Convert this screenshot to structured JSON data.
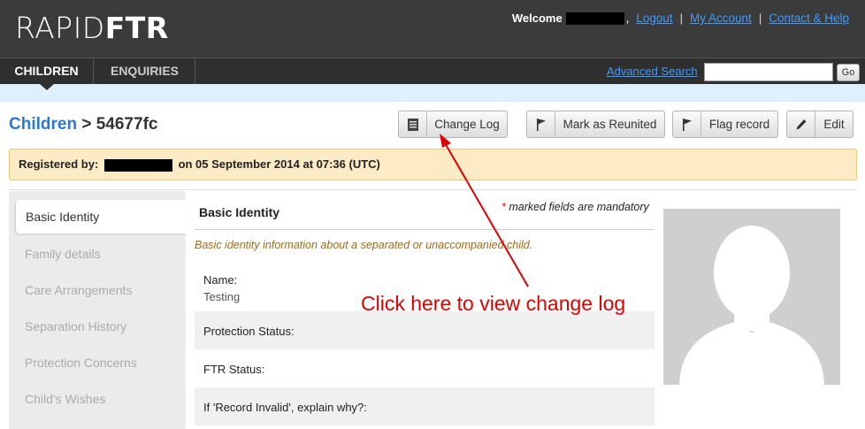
{
  "header": {
    "logo_light": "RAPID",
    "logo_bold": "FTR",
    "welcome_label": "Welcome",
    "logout": "Logout",
    "my_account": "My Account",
    "contact_help": "Contact & Help",
    "separator": "|"
  },
  "nav": {
    "tabs": [
      {
        "label": "CHILDREN",
        "active": true
      },
      {
        "label": "ENQUIRIES",
        "active": false
      }
    ],
    "advanced_search": "Advanced Search",
    "search_value": "",
    "go_label": "Go"
  },
  "page": {
    "breadcrumb_root": "Children",
    "breadcrumb_sep": ">",
    "record_id": "54677fc"
  },
  "actions": {
    "change_log": "Change Log",
    "mark_reunited": "Mark as Reunited",
    "flag_record": "Flag record",
    "edit": "Edit"
  },
  "registered": {
    "label": "Registered by:",
    "detail": "on 05 September 2014 at 07:36 (UTC)"
  },
  "sidebar": {
    "items": [
      {
        "label": "Basic Identity",
        "active": true
      },
      {
        "label": "Family details",
        "active": false
      },
      {
        "label": "Care Arrangements",
        "active": false
      },
      {
        "label": "Separation History",
        "active": false
      },
      {
        "label": "Protection Concerns",
        "active": false
      },
      {
        "label": "Child's Wishes",
        "active": false
      }
    ]
  },
  "section": {
    "title": "Basic Identity",
    "mandatory_star": "*",
    "mandatory_text": "marked fields are mandatory",
    "description": "Basic identity information about a separated or unaccompanied child."
  },
  "fields": [
    {
      "label": "Name:",
      "value": "Testing"
    },
    {
      "label": "Protection Status:",
      "value": ""
    },
    {
      "label": "FTR Status:",
      "value": ""
    },
    {
      "label": "If 'Record Invalid', explain why?:",
      "value": ""
    }
  ],
  "annotation": {
    "text": "Click here to view change log",
    "color": "#e10000"
  },
  "colors": {
    "header_bg": "#3b3b3b",
    "link": "#3e9bff",
    "breadcrumb": "#2a78d1",
    "registered_bg": "#fcebc4",
    "subbar_bg": "#dff0fd"
  },
  "icons": {
    "change_log": "document-list-icon",
    "mark_reunited": "flag-icon",
    "flag_record": "flag-icon",
    "edit": "pencil-icon",
    "photo": "avatar-placeholder"
  }
}
